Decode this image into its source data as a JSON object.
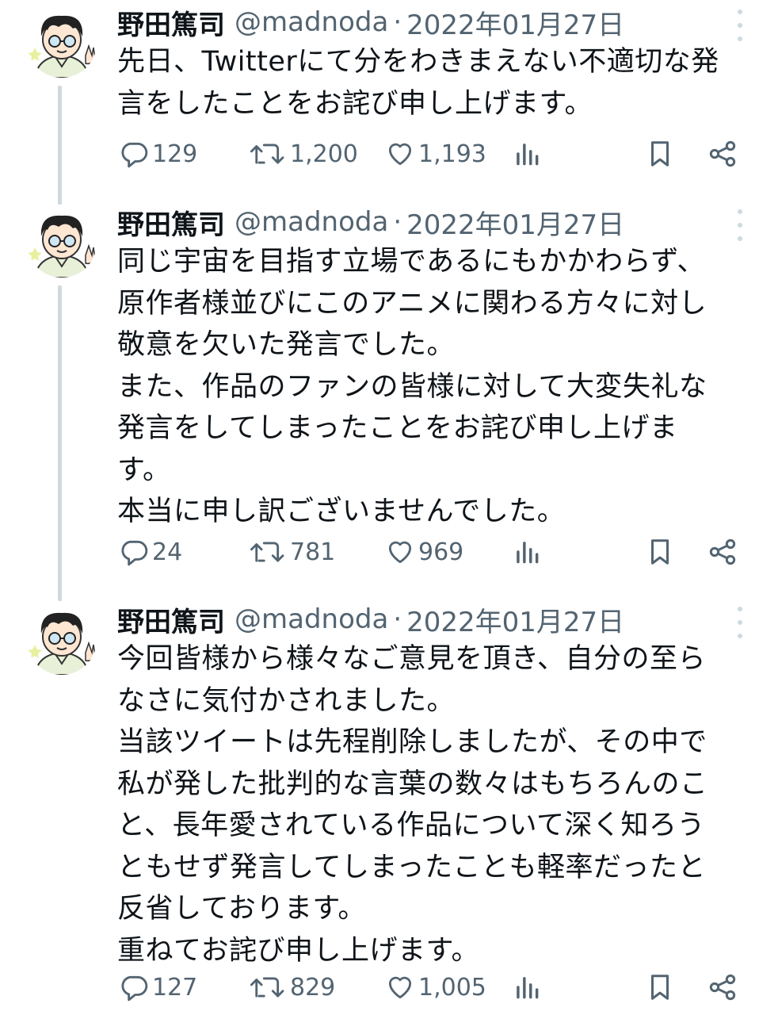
{
  "tweets": [
    {
      "author": {
        "name": "野田篤司",
        "handle": "@madnoda",
        "separator": "·",
        "date": "2022年01月27日"
      },
      "lines": [
        "先日、Twitterにて分をわきまえない不適切な発",
        "言をしたことをお詫び申し上げます。"
      ],
      "stats": {
        "replies": "129",
        "retweets": "1,200",
        "likes": "1,193"
      }
    },
    {
      "author": {
        "name": "野田篤司",
        "handle": "@madnoda",
        "separator": "·",
        "date": "2022年01月27日"
      },
      "lines": [
        "同じ宇宙を目指す立場であるにもかかわらず、",
        "原作者様並びにこのアニメに関わる方々に対し",
        "敬意を欠いた発言でした。",
        "また、作品のファンの皆様に対して大変失礼な",
        "発言をしてしまったことをお詫び申し上げま",
        "す。",
        "本当に申し訳ございませんでした。"
      ],
      "stats": {
        "replies": "24",
        "retweets": "781",
        "likes": "969"
      }
    },
    {
      "author": {
        "name": "野田篤司",
        "handle": "@madnoda",
        "separator": "·",
        "date": "2022年01月27日"
      },
      "lines": [
        "今回皆様から様々なご意見を頂き、自分の至ら",
        "なさに気付かされました。",
        "当該ツイートは先程削除しましたが、その中で",
        "私が発した批判的な言葉の数々はもちろんのこ",
        "と、長年愛されている作品について深く知ろう",
        "ともせず発言してしまったことも軽率だったと",
        "反省しております。",
        "重ねてお詫び申し上げます。"
      ],
      "stats": {
        "replies": "127",
        "retweets": "829",
        "likes": "1,005"
      }
    }
  ],
  "icons": [
    "reply-icon",
    "retweet-icon",
    "like-icon",
    "views-icon",
    "bookmark-icon",
    "share-icon",
    "more-icon"
  ],
  "colors": {
    "text": "#0f1419",
    "secondary": "#536471",
    "thread_line": "#cfd9de",
    "background": "#ffffff"
  }
}
